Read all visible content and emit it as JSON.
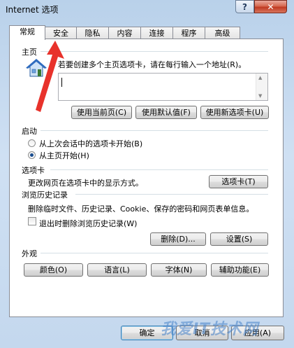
{
  "window": {
    "title": "Internet 选项",
    "help_label": "?",
    "close_label": "✕"
  },
  "tabs": [
    {
      "label": "常规",
      "active": true
    },
    {
      "label": "安全",
      "active": false
    },
    {
      "label": "隐私",
      "active": false
    },
    {
      "label": "内容",
      "active": false
    },
    {
      "label": "连接",
      "active": false
    },
    {
      "label": "程序",
      "active": false
    },
    {
      "label": "高级",
      "active": false
    }
  ],
  "home": {
    "section_label": "主页",
    "description": "若要创建多个主页选项卡，请在每行输入一个地址(R)。",
    "textarea_value": "",
    "buttons": [
      "使用当前页(C)",
      "使用默认值(F)",
      "使用新选项卡(U)"
    ]
  },
  "startup": {
    "section_label": "启动",
    "options": [
      {
        "label": "从上次会话中的选项卡开始(B)",
        "checked": false
      },
      {
        "label": "从主页开始(H)",
        "checked": true
      }
    ]
  },
  "tabs_section": {
    "section_label": "选项卡",
    "description": "更改网页在选项卡中的显示方式。",
    "button": "选项卡(T)"
  },
  "history": {
    "section_label": "浏览历史记录",
    "description": "删除临时文件、历史记录、Cookie、保存的密码和网页表单信息。",
    "checkbox_label": "退出时删除浏览历史记录(W)",
    "checkbox_checked": false,
    "delete_button": "删除(D)...",
    "settings_button": "设置(S)"
  },
  "appearance": {
    "section_label": "外观",
    "buttons": [
      "颜色(O)",
      "语言(L)",
      "字体(N)",
      "辅助功能(E)"
    ]
  },
  "footer": {
    "ok": "确定",
    "cancel": "取消",
    "apply": "应用(A)"
  },
  "watermark": "我爱IT技术网",
  "colors": {
    "annotation_arrow": "#e8322b",
    "window_frame": "#b9d1ea"
  }
}
